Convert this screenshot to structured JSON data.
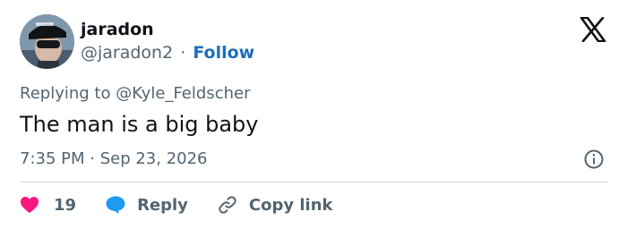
{
  "user": {
    "name": "jaradon",
    "handle": "@jaradon2",
    "separator": "·",
    "follow_label": "Follow"
  },
  "reply": {
    "prefix": "Replying to",
    "target": "@Kyle_Feldscher"
  },
  "tweet": {
    "text": "The man is a big baby",
    "timestamp": "7:35 PM · Sep 23, 2026"
  },
  "actions": {
    "like_count": "19",
    "reply_label": "Reply",
    "copy_label": "Copy link"
  },
  "icons": {
    "brand": "x-logo-icon",
    "info": "info-icon",
    "like": "heart-icon",
    "reply": "speech-bubble-icon",
    "copy": "link-icon"
  },
  "colors": {
    "text": "#0f1419",
    "muted": "#536471",
    "link": "#1d70b8",
    "heart": "#f91880",
    "reply_bubble": "#1d9bf0",
    "divider": "#cfd9de"
  }
}
